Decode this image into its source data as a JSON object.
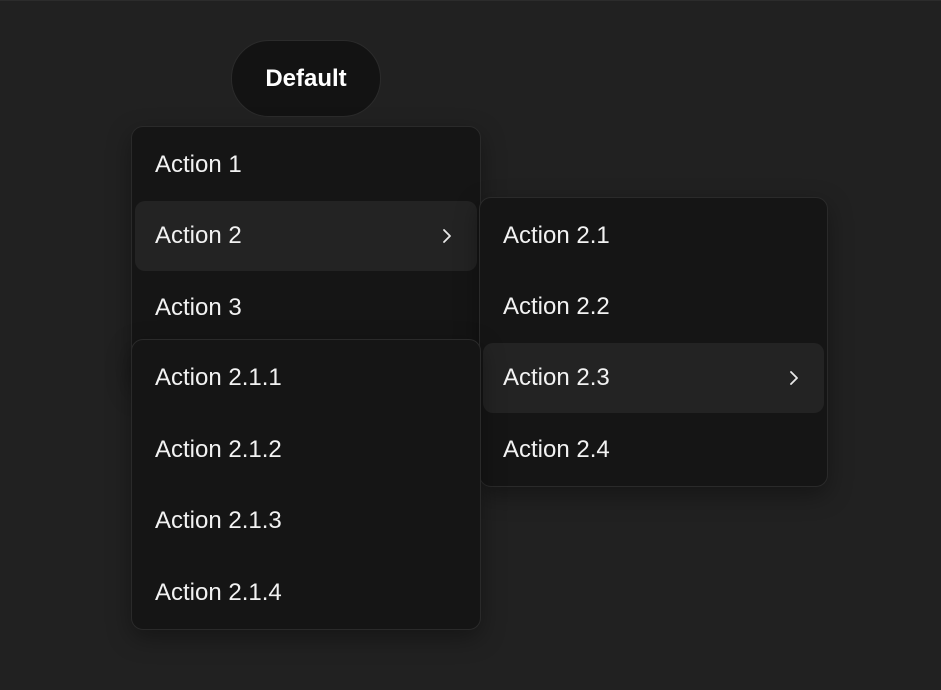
{
  "trigger": {
    "label": "Default"
  },
  "menu_level1": {
    "items": [
      {
        "label": "Action 1"
      },
      {
        "label": "Action 2",
        "has_submenu": true,
        "active": true
      },
      {
        "label": "Action 3"
      }
    ]
  },
  "menu_level2": {
    "items": [
      {
        "label": "Action 2.1"
      },
      {
        "label": "Action 2.2"
      },
      {
        "label": "Action 2.3",
        "has_submenu": true,
        "active": true
      },
      {
        "label": "Action 2.4"
      }
    ]
  },
  "menu_level3": {
    "items": [
      {
        "label": "Action 2.1.1"
      },
      {
        "label": "Action 2.1.2"
      },
      {
        "label": "Action 2.1.3"
      },
      {
        "label": "Action 2.1.4"
      }
    ]
  },
  "icons": {
    "submenu": "chevron-right-icon"
  },
  "colors": {
    "background": "#212121",
    "menu_surface": "#151515",
    "item_active": "#232323",
    "text": "#f2f2f2"
  }
}
